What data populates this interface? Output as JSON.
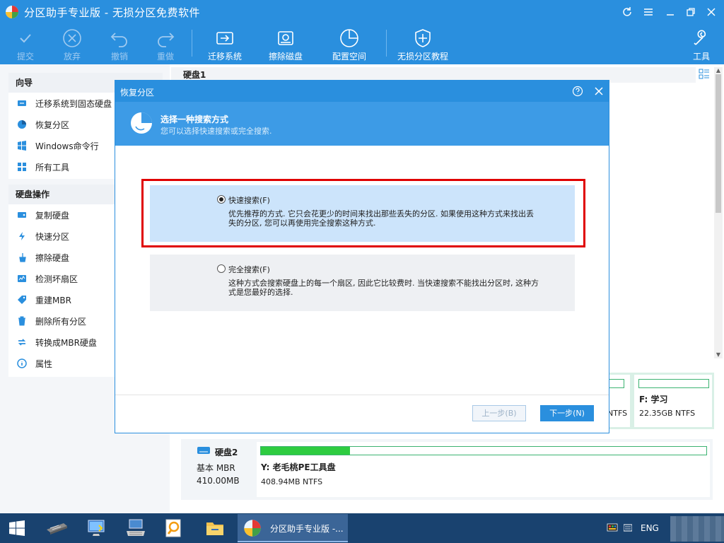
{
  "window": {
    "title": "分区助手专业版 - 无损分区免费软件",
    "controls": [
      "refresh-icon",
      "menu-icon",
      "restore-icon",
      "close-icon"
    ]
  },
  "toolbar": {
    "items": [
      {
        "label": "提交",
        "icon": "check-icon",
        "enabled": false
      },
      {
        "label": "放弃",
        "icon": "cancel-icon",
        "enabled": false
      },
      {
        "label": "撤销",
        "icon": "undo-icon",
        "enabled": false
      },
      {
        "label": "重做",
        "icon": "redo-icon",
        "enabled": false
      },
      {
        "label": "迁移系统",
        "icon": "migrate-icon",
        "enabled": true
      },
      {
        "label": "擦除磁盘",
        "icon": "wipe-disk-icon",
        "enabled": true
      },
      {
        "label": "配置空间",
        "icon": "allocate-space-icon",
        "enabled": true
      },
      {
        "label": "无损分区教程",
        "icon": "shield-icon",
        "enabled": true
      },
      {
        "label": "工具",
        "icon": "tools-icon",
        "enabled": true
      }
    ]
  },
  "sidebar": {
    "wizard_title": "向导",
    "wizard_items": [
      {
        "label": "迁移系统到固态硬盘",
        "icon": "migrate-ssd-icon"
      },
      {
        "label": "恢复分区",
        "icon": "recover-partition-icon"
      },
      {
        "label": "Windows命令行",
        "icon": "windows-icon"
      },
      {
        "label": "所有工具",
        "icon": "all-tools-icon"
      }
    ],
    "disk_ops_title": "硬盘操作",
    "disk_ops_items": [
      {
        "label": "复制硬盘",
        "icon": "copy-disk-icon"
      },
      {
        "label": "快速分区",
        "icon": "lightning-icon"
      },
      {
        "label": "擦除硬盘",
        "icon": "broom-icon"
      },
      {
        "label": "检测坏扇区",
        "icon": "check-sector-icon"
      },
      {
        "label": "重建MBR",
        "icon": "tag-icon"
      },
      {
        "label": "删除所有分区",
        "icon": "trash-icon"
      },
      {
        "label": "转换成MBR硬盘",
        "icon": "convert-icon"
      },
      {
        "label": "属性",
        "icon": "info-icon"
      }
    ]
  },
  "main": {
    "disk1_label": "硬盘1",
    "partitions": [
      {
        "name": "",
        "info": "NTFS"
      },
      {
        "name": "F: 学习",
        "info": "22.35GB NTFS"
      }
    ],
    "disk2": {
      "name": "硬盘2",
      "type": "基本 MBR",
      "size": "410.00MB",
      "partition_name": "Y: 老毛桃PE工具盘",
      "partition_info": "408.94MB NTFS",
      "usage_fraction": 0.2
    }
  },
  "dialog": {
    "title": "恢复分区",
    "header_title": "选择一种搜索方式",
    "header_subtitle": "您可以选择快速搜索或完全搜索.",
    "options": [
      {
        "label": "快速搜索(F)",
        "selected": true,
        "description": "优先推荐的方式. 它只会花更少的时间来找出那些丢失的分区. 如果使用这种方式来找出丢失的分区, 您可以再使用完全搜索这种方式."
      },
      {
        "label": "完全搜索(F)",
        "selected": false,
        "description": "这种方式会搜索硬盘上的每一个扇区, 因此它比较费时. 当快速搜索不能找出分区时, 这种方式是您最好的选择."
      }
    ],
    "prev_button": "上一步(B)",
    "next_button": "下一步(N)"
  },
  "taskbar": {
    "apps": [
      "start-icon",
      "chip-icon",
      "computer-icon",
      "keyboard-icon",
      "search-tool-icon",
      "folder-icon"
    ],
    "active_app": "分区助手专业版 -...",
    "tray_lang": "ENG"
  },
  "colors": {
    "accent": "#2a8fde",
    "highlight": "#e00000",
    "partition_bar": "#2ecc40"
  }
}
